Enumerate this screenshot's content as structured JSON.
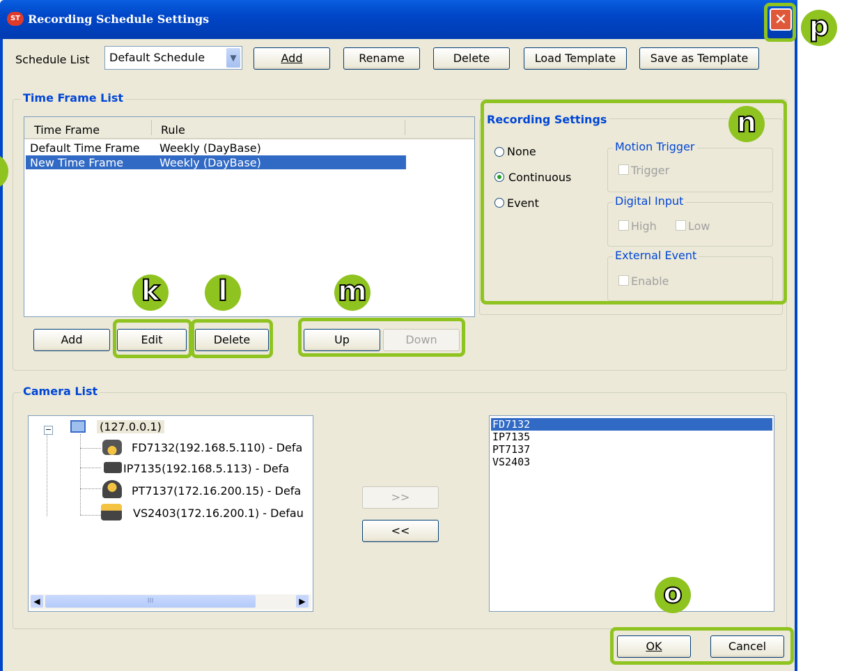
{
  "window": {
    "title": "Recording Schedule Settings",
    "app_icon": "ST",
    "close_glyph": "✕"
  },
  "schedule": {
    "label": "Schedule List",
    "selected": "Default Schedule",
    "buttons": {
      "add": "Add",
      "rename": "Rename",
      "delete": "Delete",
      "load_template": "Load Template",
      "save_template": "Save as Template"
    }
  },
  "time_frame": {
    "group_title": "Time Frame List",
    "columns": [
      "Time Frame",
      "Rule"
    ],
    "rows": [
      {
        "name": "Default Time Frame",
        "rule": "Weekly (DayBase)"
      },
      {
        "name": "New Time Frame",
        "rule": "Weekly (DayBase)"
      }
    ],
    "buttons": {
      "add": "Add",
      "edit": "Edit",
      "delete": "Delete",
      "up": "Up",
      "down": "Down"
    }
  },
  "recording": {
    "group_title": "Recording Settings",
    "modes": {
      "none": "None",
      "continuous": "Continuous",
      "event": "Event"
    },
    "selected_mode": "Continuous",
    "motion_trigger": {
      "title": "Motion Trigger",
      "trigger": "Trigger"
    },
    "digital_input": {
      "title": "Digital Input",
      "high": "High",
      "low": "Low"
    },
    "external_event": {
      "title": "External Event",
      "enable": "Enable"
    }
  },
  "camera_list": {
    "group_title": "Camera List",
    "server": "(127.0.0.1)",
    "tree": [
      {
        "label": "FD7132(192.168.5.110) - Defa",
        "icon": "dome-camera-icon"
      },
      {
        "label": "IP7135(192.168.5.113) - Defa",
        "icon": "cube-camera-icon"
      },
      {
        "label": "PT7137(172.16.200.15) - Defa",
        "icon": "ptz-camera-icon"
      },
      {
        "label": "VS2403(172.16.200.1) - Defau",
        "icon": "video-server-icon"
      }
    ],
    "add_button": ">>",
    "remove_button": "<<",
    "selected_cameras": [
      "FD7132",
      "IP7135",
      "PT7137",
      "VS2403"
    ],
    "scroll_grip": "III"
  },
  "footer": {
    "ok": "OK",
    "cancel": "Cancel"
  },
  "callouts": {
    "k": "k",
    "l": "l",
    "m": "m",
    "n": "n",
    "o": "o",
    "p": "p"
  },
  "colors": {
    "highlight": "#8fc31f",
    "title_blue": "#0046d5",
    "selection": "#316ac5"
  }
}
